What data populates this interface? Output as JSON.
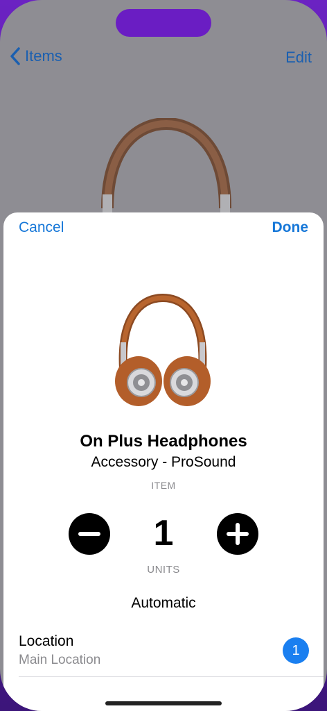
{
  "nav": {
    "back_label": "Items",
    "edit_label": "Edit"
  },
  "sheet": {
    "cancel_label": "Cancel",
    "done_label": "Done",
    "product": {
      "name": "On Plus Headphones",
      "subtitle": "Accessory - ProSound",
      "type_label": "ITEM"
    },
    "stepper": {
      "quantity": "1",
      "units_label": "UNITS"
    },
    "mode_label": "Automatic",
    "location": {
      "title": "Location",
      "value": "Main Location",
      "badge": "1"
    }
  },
  "colors": {
    "accent": "#1677d8",
    "badge": "#1a7ff0",
    "device_frame": "#6b22c2"
  },
  "icons": {
    "back": "chevron-left-icon",
    "minus": "minus-circle-icon",
    "plus": "plus-circle-icon"
  }
}
